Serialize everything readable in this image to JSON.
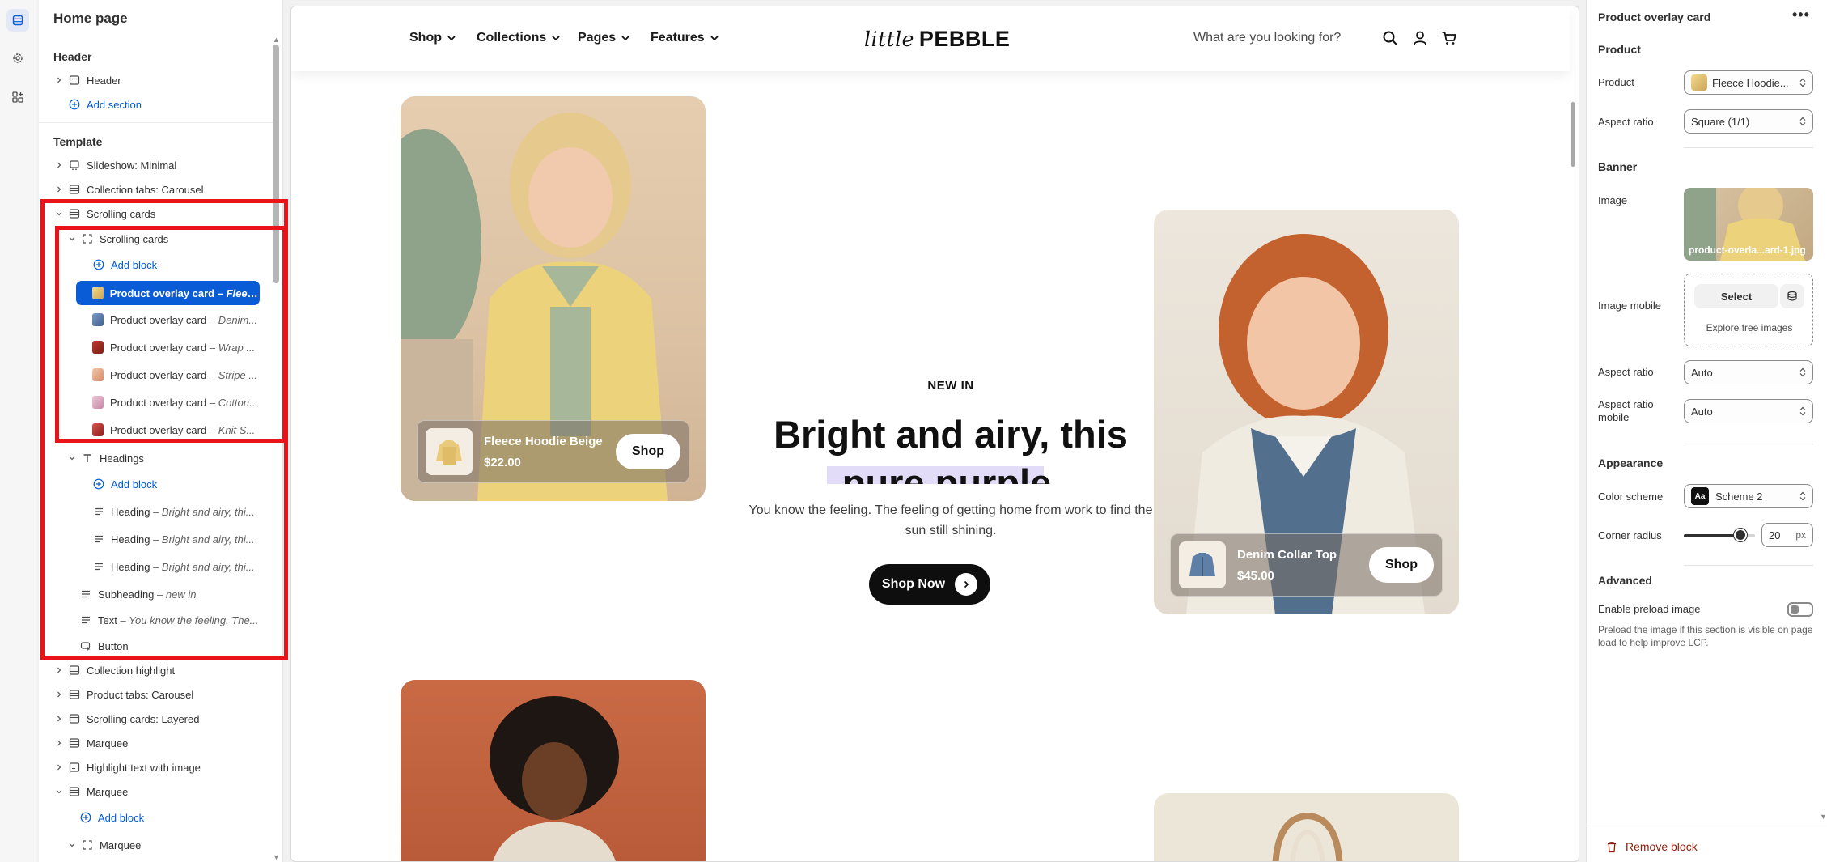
{
  "sidebar": {
    "title": "Home page",
    "header_group": "Header",
    "header_item": "Header",
    "add_section": "Add section",
    "template_group": "Template",
    "items": [
      {
        "label": "Slideshow: Minimal"
      },
      {
        "label": "Collection tabs: Carousel"
      },
      {
        "label": "Scrolling cards"
      },
      {
        "label": "Scrolling cards"
      },
      {
        "label": "Add block"
      },
      {
        "label": "Product overlay card",
        "sub": "– Fleec..."
      },
      {
        "label": "Product overlay card",
        "sub": "– Denim..."
      },
      {
        "label": "Product overlay card",
        "sub": "– Wrap ..."
      },
      {
        "label": "Product overlay card",
        "sub": "– Stripe ..."
      },
      {
        "label": "Product overlay card",
        "sub": "– Cotton..."
      },
      {
        "label": "Product overlay card",
        "sub": "– Knit S..."
      },
      {
        "label": "Headings"
      },
      {
        "label": "Add block"
      },
      {
        "label": "Heading",
        "sub": "– Bright and airy, thi..."
      },
      {
        "label": "Heading",
        "sub": "– Bright and airy, thi..."
      },
      {
        "label": "Heading",
        "sub": "– Bright and airy, thi..."
      },
      {
        "label": "Subheading",
        "sub": "– new in"
      },
      {
        "label": "Text",
        "sub": "– You know the feeling. The..."
      },
      {
        "label": "Button"
      },
      {
        "label": "Collection highlight"
      },
      {
        "label": "Product tabs: Carousel"
      },
      {
        "label": "Scrolling cards: Layered"
      },
      {
        "label": "Marquee"
      },
      {
        "label": "Highlight text with image"
      },
      {
        "label": "Marquee"
      },
      {
        "label": "Add block"
      },
      {
        "label": "Marquee"
      }
    ]
  },
  "preview": {
    "nav": [
      "Shop",
      "Collections",
      "Pages",
      "Features"
    ],
    "logo_italic": "little",
    "logo_bold": "PEBBLE",
    "search_placeholder": "What are you looking for?",
    "card1": {
      "name": "Fleece Hoodie Beige",
      "price": "$22.00",
      "button": "Shop"
    },
    "card2": {
      "name": "Denim Collar Top",
      "price": "$45.00",
      "button": "Shop"
    },
    "subheading": "NEW IN",
    "heading_line1": "Bright and airy, this",
    "heading_line2": "pure purple",
    "text": "You know the feeling. The feeling of getting home from work to find the sun still shining.",
    "button": "Shop Now"
  },
  "settings": {
    "title": "Product overlay card",
    "more": "•••",
    "product_section": "Product",
    "product_label": "Product",
    "product_value": "Fleece Hoodie...",
    "aspect_label": "Aspect ratio",
    "aspect_value": "Square (1/1)",
    "banner_section": "Banner",
    "image_label": "Image",
    "image_caption": "product-overla...ard-1.jpg",
    "image_mobile_label": "Image mobile",
    "select_label": "Select",
    "explore_label": "Explore free images",
    "aspect2_label": "Aspect ratio",
    "aspect2_value": "Auto",
    "aspect_mobile_label": "Aspect ratio mobile",
    "aspect_mobile_value": "Auto",
    "appearance_section": "Appearance",
    "color_scheme_label": "Color scheme",
    "color_scheme_value": "Scheme 2",
    "scheme_badge": "Aa",
    "corner_label": "Corner radius",
    "corner_value": "20",
    "corner_unit": "px",
    "corner_level": 0.8,
    "advanced_section": "Advanced",
    "preload_label": "Enable preload image",
    "preload_help": "Preload the image if this section is visible on page load to help improve LCP.",
    "remove_label": "Remove block"
  },
  "colors": {
    "accent": "#0a5cd6",
    "highlight_box": "#e8141a",
    "purple_highlight": "#e2dcf8",
    "danger": "#8e1f0b"
  }
}
